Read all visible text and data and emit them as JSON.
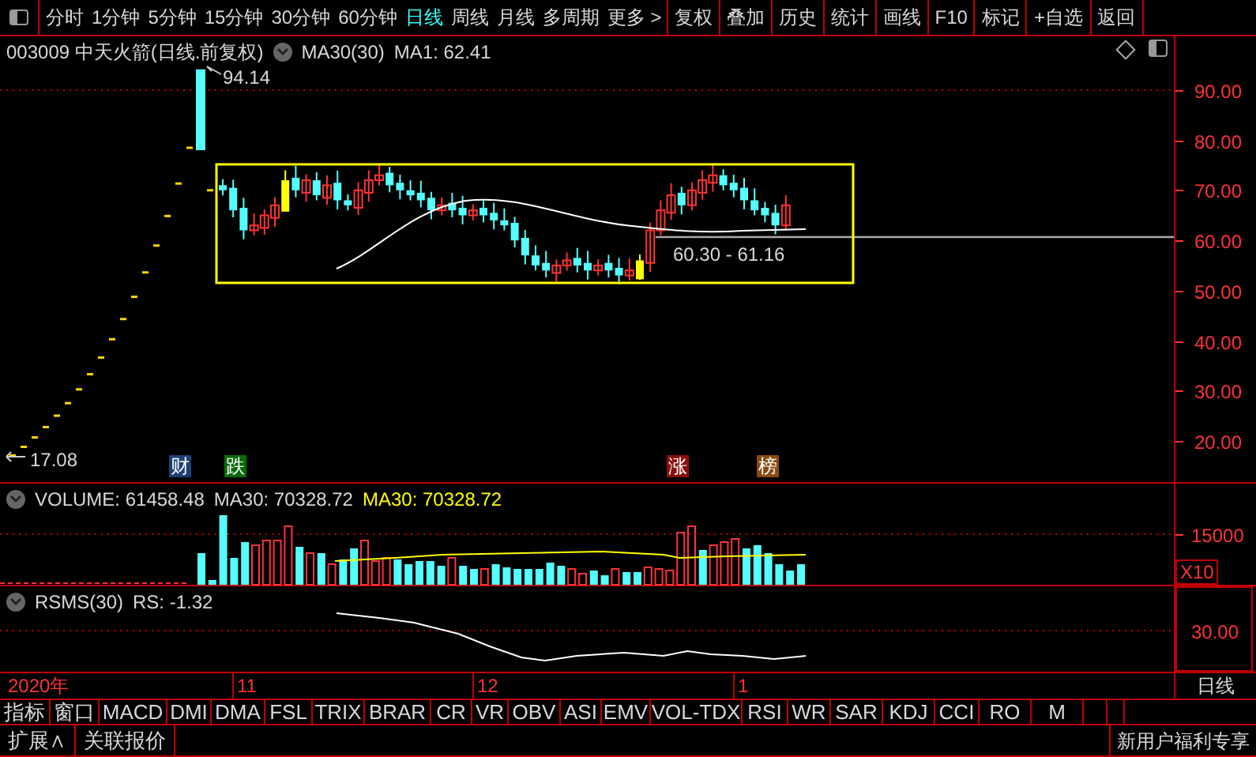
{
  "toolbar": {
    "periods": [
      {
        "label": "分时",
        "selected": false
      },
      {
        "label": "1分钟",
        "selected": false
      },
      {
        "label": "5分钟",
        "selected": false
      },
      {
        "label": "15分钟",
        "selected": false
      },
      {
        "label": "30分钟",
        "selected": false
      },
      {
        "label": "60分钟",
        "selected": false
      },
      {
        "label": "日线",
        "selected": true
      },
      {
        "label": "周线",
        "selected": false
      },
      {
        "label": "月线",
        "selected": false
      },
      {
        "label": "多周期",
        "selected": false
      },
      {
        "label": "更多 >",
        "selected": false
      }
    ],
    "buttons": [
      "复权",
      "叠加",
      "历史",
      "统计",
      "画线",
      "F10",
      "标记",
      "+自选",
      "返回"
    ]
  },
  "chart_header": {
    "symbol": "003009 中天火箭(日线.前复权)",
    "indicator": "MA30(30)",
    "value": "MA1: 62.41"
  },
  "main_chart": {
    "price_axis": [
      "90.00",
      "80.00",
      "70.00",
      "60.00",
      "50.00",
      "40.00",
      "30.00",
      "20.00"
    ],
    "high_label": "94.14",
    "low_label": "17.08",
    "range_label": "60.30 - 61.16",
    "events": [
      {
        "label": "财",
        "color": "#1d3f73"
      },
      {
        "label": "跌",
        "color": "#0b6b0b"
      },
      {
        "label": "涨",
        "color": "#8a1010"
      },
      {
        "label": "榜",
        "color": "#8a4a10"
      }
    ]
  },
  "volume_panel": {
    "title": "VOLUME: 61458.48",
    "ma_white": "MA30: 70328.72",
    "ma_yellow": "MA30: 70328.72",
    "axis": [
      "15000"
    ],
    "unit": "X10"
  },
  "rsms_panel": {
    "title": "RSMS(30)",
    "value": "RS: -1.32",
    "axis": [
      "30.00"
    ]
  },
  "date_axis": {
    "labels": [
      "2020年",
      "11",
      "12",
      "1"
    ],
    "period": "日线"
  },
  "indicator_tabs": [
    "指标",
    "窗口",
    "MACD",
    "DMI",
    "DMA",
    "FSL",
    "TRIX",
    "BRAR",
    "CR",
    "VR",
    "OBV",
    "ASI",
    "EMV",
    "VOL-TDX",
    "RSI",
    "WR",
    "SAR",
    "KDJ",
    "CCI",
    "RO",
    "M"
  ],
  "bottom_bar": {
    "items": [
      "扩展∧",
      "关联报价"
    ],
    "promo": "新用户福利专享"
  }
}
